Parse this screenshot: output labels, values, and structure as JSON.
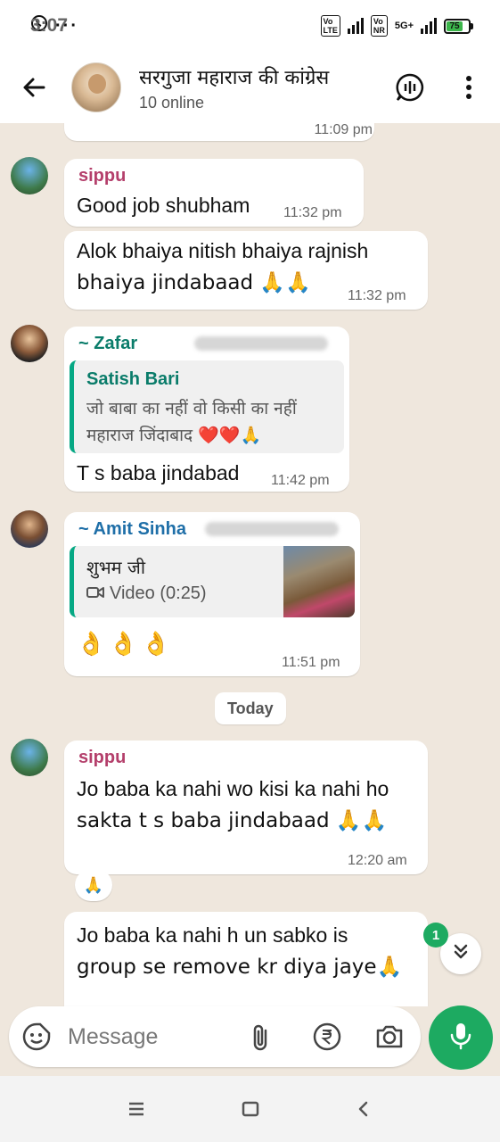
{
  "status_bar": {
    "time": "3:07",
    "dots": "···",
    "network": "5G+",
    "battery": "75"
  },
  "header": {
    "title": "सरगुजा महाराज की कांग्रेस",
    "subtitle": "10 online"
  },
  "messages": [
    {
      "id": "m0",
      "time": "11:09 pm"
    },
    {
      "id": "m1",
      "sender": "sippu",
      "text": "Good job shubham",
      "time": "11:32 pm"
    },
    {
      "id": "m2",
      "text": "Alok bhaiya nitish bhaiya rajnish bhaiya jindabaad 🙏🙏",
      "line1": "Alok bhaiya nitish bhaiya rajnish",
      "line2": "bhaiya jindabaad 🙏🙏",
      "time": "11:32 pm"
    },
    {
      "id": "m3",
      "sender": "~ Zafar",
      "quote_author": "Satish Bari",
      "quote_line1": "जो बाबा का नहीं वो किसी का नहीं",
      "quote_line2": "महाराज जिंदाबाद ❤️❤️🙏",
      "text": "T s baba jindabad",
      "time": "11:42 pm"
    },
    {
      "id": "m4",
      "sender": "~ Amit Sinha",
      "quote_author": "शुभम जी",
      "quote_media": "Video (0:25)",
      "text": "👌👌👌",
      "time": "11:51 pm"
    },
    {
      "id": "m5",
      "sender": "sippu",
      "line1": "Jo baba ka nahi wo kisi ka nahi ho",
      "line2": "sakta t s baba jindabaad 🙏🙏",
      "time": "12:20 am",
      "reaction": "🙏"
    },
    {
      "id": "m6",
      "line1": "Jo baba ka nahi h un sabko is",
      "line2": "group se remove kr diya jaye🙏"
    }
  ],
  "date_separator": "Today",
  "unread_count": "1",
  "composer": {
    "placeholder": "Message"
  },
  "colors": {
    "accent": "#1daa61",
    "sender_sippu": "#b43f6b",
    "sender_zafar": "#0a7c6a",
    "sender_amit": "#1f6fa8",
    "quote_bar": "#06a884"
  },
  "icons": [
    "back-arrow-icon",
    "voice-chat-icon",
    "more-vert-icon",
    "sticker-icon",
    "attach-icon",
    "rupee-payment-icon",
    "camera-icon",
    "mic-icon",
    "double-chevron-down-icon",
    "video-camera-icon",
    "nav-menu-icon",
    "nav-home-icon",
    "nav-back-icon"
  ]
}
